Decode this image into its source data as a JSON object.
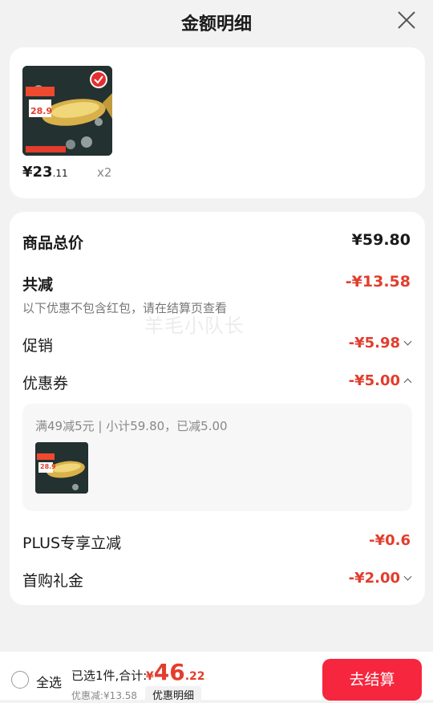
{
  "header": {
    "title": "金额明细"
  },
  "product": {
    "price_int": "¥23",
    "price_dec": ".11",
    "qty": "x2",
    "badge_text": "28.9"
  },
  "summary": {
    "total_label": "商品总价",
    "total_value": "¥59.80",
    "reduce_label": "共减",
    "reduce_value": "-¥13.58",
    "note": "以下优惠不包含红包，请在结算页查看",
    "watermark": "羊毛小队长",
    "promo_label": "促销",
    "promo_value": "-¥5.98",
    "coupon_label": "优惠券",
    "coupon_value": "-¥5.00",
    "coupon_detail": "满49减5元 | 小计59.80，已减5.00",
    "plus_label": "PLUS专享立减",
    "plus_value": "-¥0.6",
    "firstbuy_label": "首购礼金",
    "firstbuy_value": "-¥2.00"
  },
  "bottom": {
    "select_all": "全选",
    "selected_count": "已选1件,合计:",
    "total_symbol": "¥",
    "total_int": "46",
    "total_dec": ".22",
    "discount_text": "优惠减:¥13.58",
    "detail_button": "优惠明细",
    "checkout_button": "去结算"
  },
  "colors": {
    "accent_red": "#e23d2d",
    "checkout_bg": "#f5263d"
  }
}
